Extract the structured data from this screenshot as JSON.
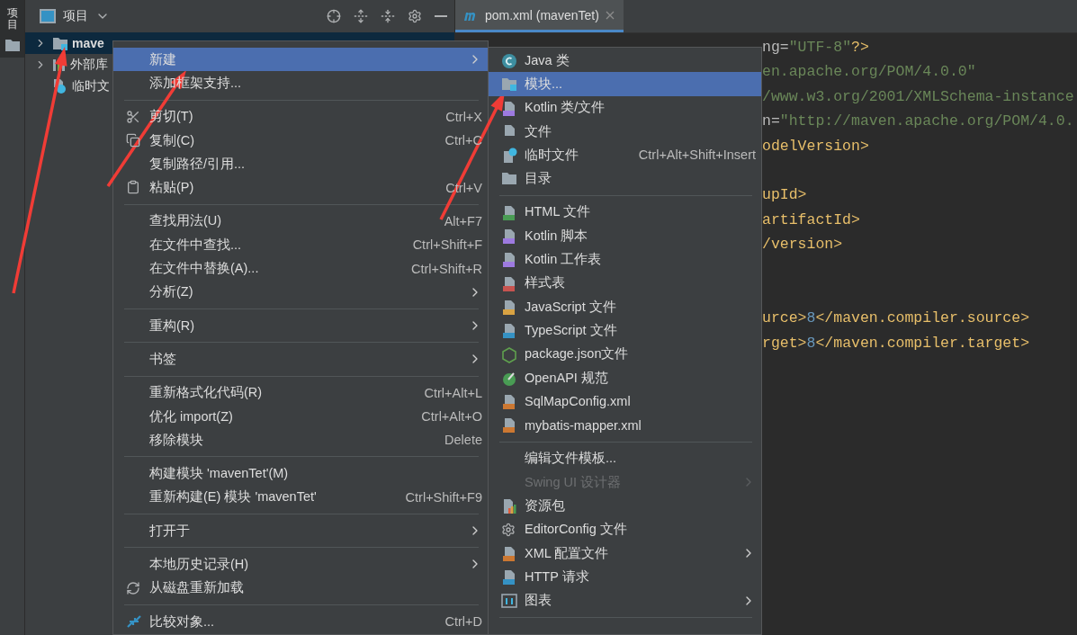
{
  "tool_strip": {
    "label": "项目",
    "selected": true
  },
  "project_panel": {
    "title": "项目",
    "tree": [
      {
        "label": "mave",
        "bold": true,
        "selected": true,
        "expanded": false
      },
      {
        "label": "外部库",
        "bold": false,
        "selected": false,
        "expanded": false
      },
      {
        "label": "临时文",
        "bold": false,
        "selected": false
      }
    ]
  },
  "editor": {
    "tabs": [
      {
        "label": "pom.xml (mavenTet)",
        "selected": true
      }
    ],
    "blocks": [
      [
        {
          "segments": [
            {
              "text": "ng=",
              "kind": "attr"
            },
            {
              "text": "\"UTF-8\"",
              "kind": "string"
            },
            {
              "text": "?>",
              "kind": "tag"
            }
          ]
        },
        {
          "segments": [
            {
              "text": "en.apache.org/POM/4.0.0\"",
              "kind": "string"
            }
          ]
        },
        {
          "segments": [
            {
              "text": "/www.w3.org/2001/XMLSchema-instance",
              "kind": "string"
            }
          ]
        },
        {
          "segments": [
            {
              "text": "n=",
              "kind": "attr"
            },
            {
              "text": "\"http://maven.apache.org/POM/4.0.",
              "kind": "string"
            }
          ]
        },
        {
          "segments": [
            {
              "text": "odelVersion>",
              "kind": "tag"
            }
          ]
        }
      ],
      [
        {
          "segments": [
            {
              "text": "upId>",
              "kind": "tag"
            }
          ]
        },
        {
          "segments": [
            {
              "text": "artifactId>",
              "kind": "tag"
            }
          ]
        },
        {
          "segments": [
            {
              "text": "/version>",
              "kind": "tag"
            }
          ]
        }
      ],
      [
        {
          "segments": [
            {
              "text": "urce>",
              "kind": "tag"
            },
            {
              "text": "8",
              "kind": "number"
            },
            {
              "text": "</maven.compiler.source>",
              "kind": "tag"
            }
          ]
        },
        {
          "segments": [
            {
              "text": "rget>",
              "kind": "tag"
            },
            {
              "text": "8",
              "kind": "number"
            },
            {
              "text": "</maven.compiler.target>",
              "kind": "tag"
            }
          ]
        }
      ]
    ]
  },
  "context_menu": {
    "groups": [
      [
        {
          "label": "新建",
          "submenu": true,
          "selected": true
        },
        {
          "label": "添加框架支持...",
          "selected": false
        }
      ],
      [
        {
          "label": "剪切(T)",
          "shortcut": "Ctrl+X",
          "selected": false
        },
        {
          "label": "复制(C)",
          "shortcut": "Ctrl+C",
          "selected": false
        },
        {
          "label": "复制路径/引用...",
          "selected": false
        },
        {
          "label": "粘贴(P)",
          "shortcut": "Ctrl+V",
          "selected": false
        }
      ],
      [
        {
          "label": "查找用法(U)",
          "shortcut": "Alt+F7",
          "selected": false
        },
        {
          "label": "在文件中查找...",
          "shortcut": "Ctrl+Shift+F",
          "selected": false
        },
        {
          "label": "在文件中替换(A)...",
          "shortcut": "Ctrl+Shift+R",
          "selected": false
        },
        {
          "label": "分析(Z)",
          "submenu": true,
          "selected": false
        }
      ],
      [
        {
          "label": "重构(R)",
          "submenu": true,
          "selected": false
        }
      ],
      [
        {
          "label": "书签",
          "submenu": true,
          "selected": false
        }
      ],
      [
        {
          "label": "重新格式化代码(R)",
          "shortcut": "Ctrl+Alt+L",
          "selected": false
        },
        {
          "label": "优化 import(Z)",
          "shortcut": "Ctrl+Alt+O",
          "selected": false
        },
        {
          "label": "移除模块",
          "shortcut": "Delete",
          "selected": false
        }
      ],
      [
        {
          "label": "构建模块 'mavenTet'(M)",
          "selected": false
        },
        {
          "label": "重新构建(E) 模块 'mavenTet'",
          "shortcut": "Ctrl+Shift+F9",
          "selected": false
        }
      ],
      [
        {
          "label": "打开于",
          "submenu": true,
          "selected": false
        }
      ],
      [
        {
          "label": "本地历史记录(H)",
          "submenu": true,
          "selected": false
        },
        {
          "label": "从磁盘重新加载",
          "selected": false
        }
      ],
      [
        {
          "label": "比较对象...",
          "shortcut": "Ctrl+D",
          "selected": false
        }
      ]
    ]
  },
  "new_submenu": {
    "groups": [
      [
        {
          "label": "Java 类",
          "selected": false
        },
        {
          "label": "模块...",
          "selected": true
        },
        {
          "label": "Kotlin 类/文件",
          "selected": false
        },
        {
          "label": "文件",
          "selected": false
        },
        {
          "label": "临时文件",
          "shortcut": "Ctrl+Alt+Shift+Insert",
          "selected": false
        },
        {
          "label": "目录",
          "selected": false
        }
      ],
      [
        {
          "label": "HTML 文件",
          "selected": false
        },
        {
          "label": "Kotlin 脚本",
          "selected": false
        },
        {
          "label": "Kotlin 工作表",
          "selected": false
        },
        {
          "label": "样式表",
          "selected": false
        },
        {
          "label": "JavaScript 文件",
          "selected": false
        },
        {
          "label": "TypeScript 文件",
          "selected": false
        },
        {
          "label": "package.json文件",
          "selected": false
        },
        {
          "label": "OpenAPI 规范",
          "selected": false
        },
        {
          "label": "SqlMapConfig.xml",
          "selected": false
        },
        {
          "label": "mybatis-mapper.xml",
          "selected": false
        }
      ],
      [
        {
          "label": "编辑文件模板...",
          "selected": false
        },
        {
          "label": "Swing UI 设计器",
          "submenu": true,
          "disabled": true,
          "selected": false
        },
        {
          "label": "资源包",
          "selected": false
        },
        {
          "label": "EditorConfig 文件",
          "selected": false
        },
        {
          "label": "XML 配置文件",
          "submenu": true,
          "selected": false
        },
        {
          "label": "HTTP 请求",
          "selected": false
        },
        {
          "label": "图表",
          "submenu": true,
          "selected": false
        }
      ]
    ]
  }
}
